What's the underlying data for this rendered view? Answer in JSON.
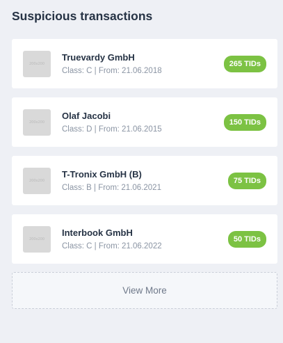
{
  "panel": {
    "title": "Suspicious transactions",
    "view_more_label": "View More",
    "badge_color": "#7cc243"
  },
  "transactions": [
    {
      "name": "Truevardy GmbH",
      "meta": "Class: C | From: 21.06.2018",
      "badge": "265 TIDs",
      "thumb_label": "200x200"
    },
    {
      "name": "Olaf Jacobi",
      "meta": "Class: D | From: 21.06.2015",
      "badge": "150 TIDs",
      "thumb_label": "200x200"
    },
    {
      "name": "T-Tronix GmbH (B)",
      "meta": "Class: B | From: 21.06.2021",
      "badge": "75 TIDs",
      "thumb_label": "200x200"
    },
    {
      "name": "Interbook GmbH",
      "meta": "Class: C | From: 21.06.2022",
      "badge": "50 TIDs",
      "thumb_label": "200x200"
    }
  ]
}
